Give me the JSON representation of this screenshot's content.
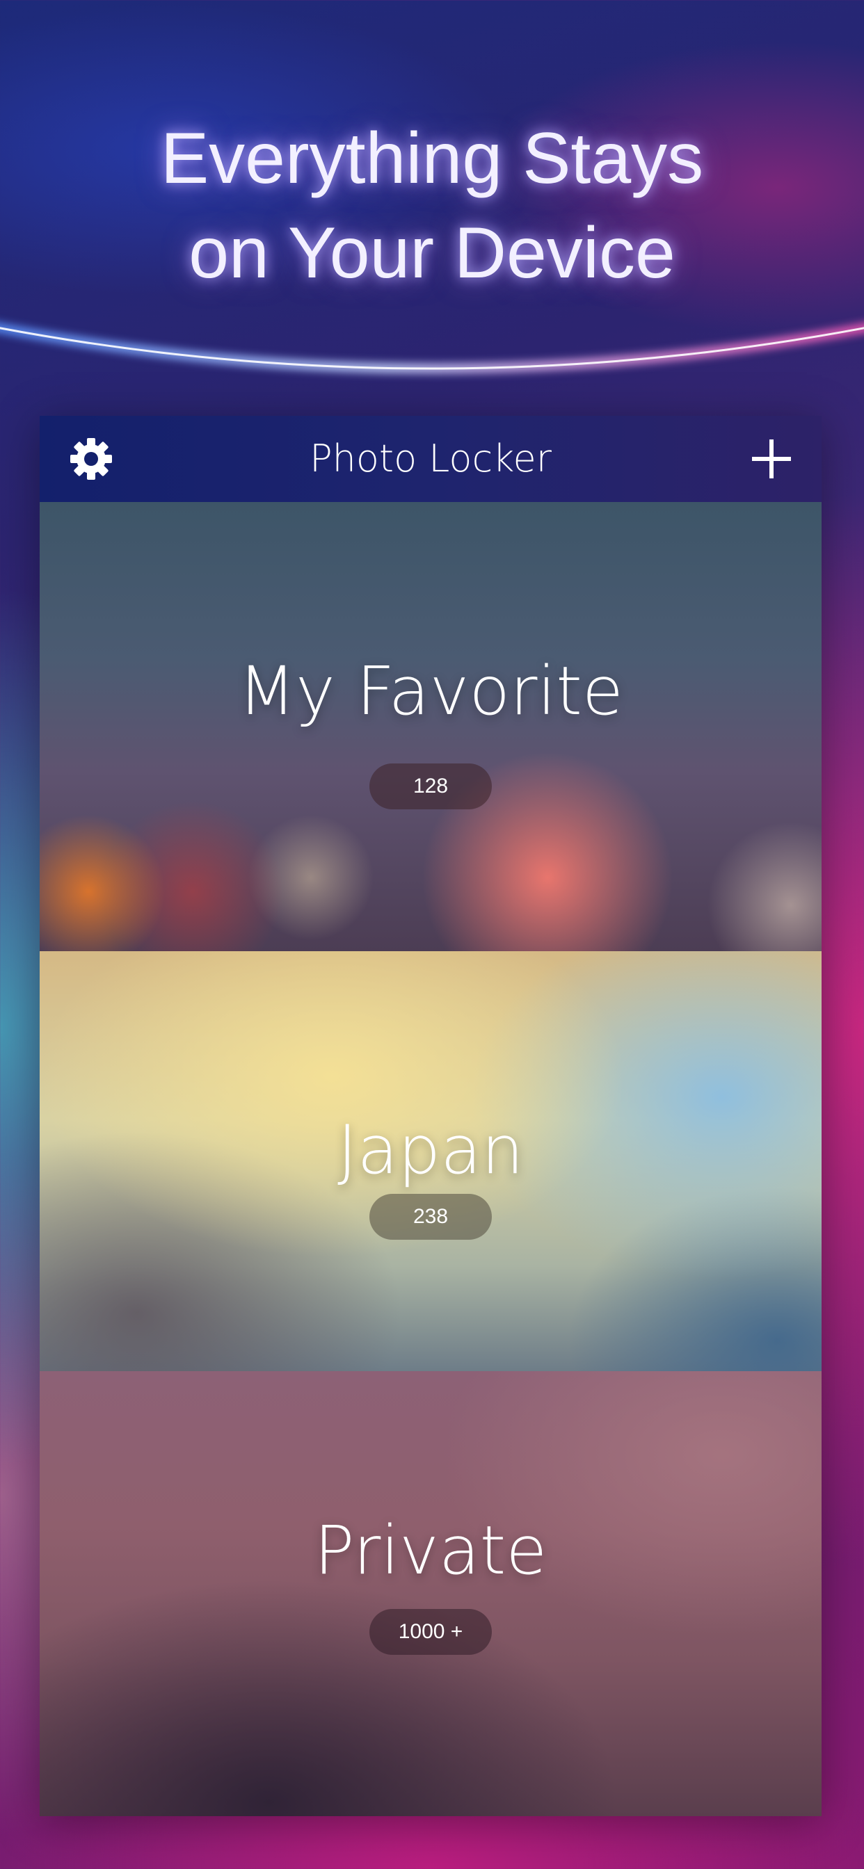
{
  "headline": {
    "line1": "Everything Stays",
    "line2": "on Your Device"
  },
  "app": {
    "title": "Photo Locker",
    "settings_icon": "gear-icon",
    "add_icon": "plus-icon"
  },
  "albums": [
    {
      "name": "My Favorite",
      "count": "128"
    },
    {
      "name": "Japan",
      "count": "238"
    },
    {
      "name": "Private",
      "count": "1000 +"
    }
  ],
  "colors": {
    "navbar": "#13206c",
    "headline_glow": "#b4aaff",
    "arc_left": "#5a8cff",
    "arc_right": "#ff4fb0"
  }
}
